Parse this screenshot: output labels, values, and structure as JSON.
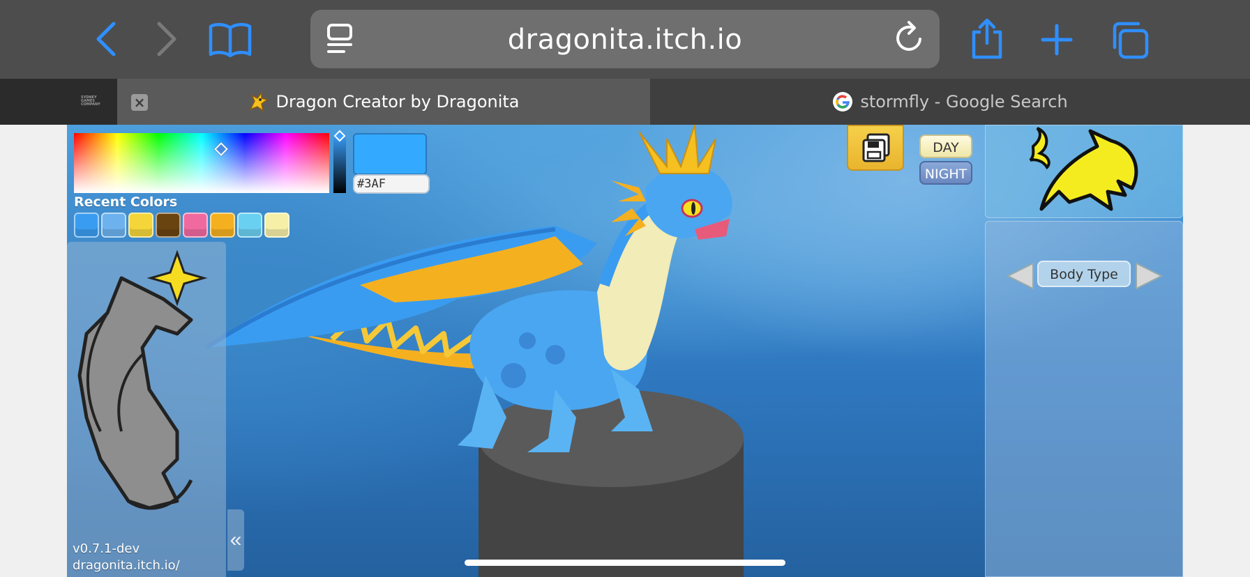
{
  "browser": {
    "url": "dragonita.itch.io",
    "tabs": [
      {
        "label": "",
        "pinned_logo": "SYDNEY GAMES COMPANY"
      },
      {
        "label": "Dragon Creator by Dragonita"
      },
      {
        "label": "stormfly - Google Search"
      }
    ]
  },
  "color_picker": {
    "hex_value": "#3AF",
    "selected_color": "#33aaff",
    "recent_label": "Recent Colors",
    "recent_colors": [
      "#3a9cf0",
      "#6db2ee",
      "#f4d63a",
      "#6a4410",
      "#f06aa0",
      "#f5b020",
      "#6ad0f2",
      "#f5efa8"
    ]
  },
  "left_panel": {
    "icon": "dragon-silhouette-icon",
    "version": "v0.7.1-dev",
    "site": "dragonita.itch.io/",
    "collapse_label": "«"
  },
  "controls": {
    "day_label": "DAY",
    "night_label": "NIGHT",
    "save_icon": "save-icon"
  },
  "right_panel": {
    "logo_icon": "dragonita-logo-icon",
    "selector_label": "Body Type"
  },
  "colors": {
    "toolbar": "#4d4d4d",
    "accent_blue": "#2f8fff",
    "dragon_blue": "#3a9cf0",
    "dragon_yellow": "#f5b020"
  }
}
